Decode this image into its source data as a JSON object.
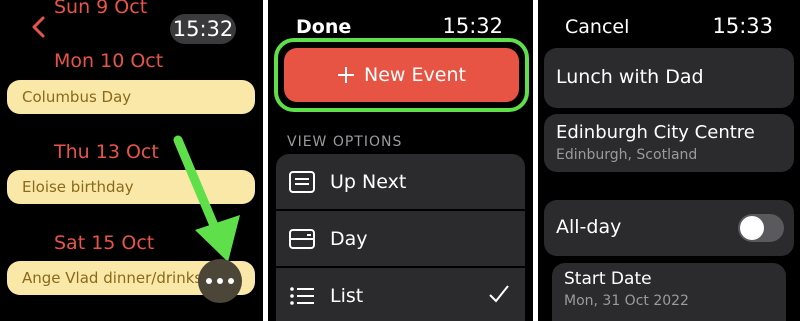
{
  "calendar": {
    "time": "15:32",
    "partial_date": "Sun 9 Oct",
    "days": [
      {
        "date": "Mon 10 Oct",
        "event": "Columbus Day"
      },
      {
        "date": "Thu 13 Oct",
        "event": "Eloise birthday"
      },
      {
        "date": "Sat 15 Oct",
        "event": "Ange Vlad dinner/drinks"
      }
    ],
    "icons": {
      "back": "chevron-left-icon",
      "more": "ellipsis-icon",
      "arrow": "pointer-arrow-icon"
    }
  },
  "options": {
    "done_label": "Done",
    "time": "15:32",
    "new_event_label": "New Event",
    "view_options_label": "VIEW OPTIONS",
    "items": [
      {
        "label": "Up Next",
        "icon": "up-next-icon",
        "selected": false
      },
      {
        "label": "Day",
        "icon": "day-icon",
        "selected": false
      },
      {
        "label": "List",
        "icon": "list-icon",
        "selected": true
      }
    ]
  },
  "new_event": {
    "cancel_label": "Cancel",
    "time": "15:33",
    "title": "Lunch with Dad",
    "location_name": "Edinburgh City Centre",
    "location_detail": "Edinburgh, Scotland",
    "all_day_label": "All-day",
    "all_day_on": false,
    "start_date_label": "Start Date",
    "start_date_value": "Mon, 31 Oct 2022"
  },
  "colors": {
    "accent_red": "#e8544a",
    "event_yellow": "#fae8a8",
    "highlight_green": "#5fe04a"
  }
}
